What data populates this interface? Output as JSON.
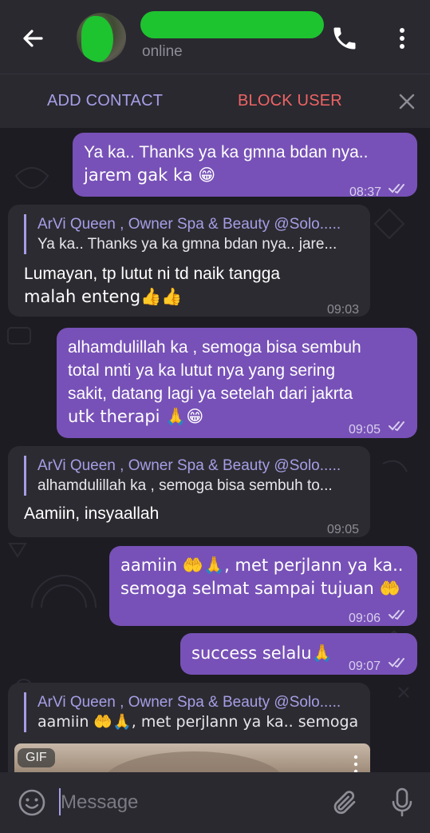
{
  "header": {
    "status": "online",
    "icons": {
      "back": "arrow-left-icon",
      "call": "phone-icon",
      "menu": "more-vertical-icon"
    }
  },
  "actionbar": {
    "add_contact": "ADD CONTACT",
    "block_user": "BLOCK USER",
    "close_icon": "close-icon"
  },
  "colors": {
    "outgoing_bubble": "#7751b7",
    "incoming_bubble": "#2c2b31",
    "accent": "#a59ee6",
    "danger": "#ee6464"
  },
  "messages": [
    {
      "direction": "out",
      "lines": [
        "Ya ka.. Thanks ya ka gmna bdan nya..",
        "jarem gak ka 😁"
      ],
      "time": "08:37",
      "read": true
    },
    {
      "direction": "in",
      "reply_name": "ArVi Queen , Owner Spa & Beauty @Solo.....",
      "reply_text": "Ya ka.. Thanks ya ka gmna bdan nya.. jare...",
      "lines": [
        "Lumayan, tp lutut ni td naik tangga",
        "malah enteng👍👍"
      ],
      "time": "09:03"
    },
    {
      "direction": "out",
      "lines": [
        "alhamdulillah ka , semoga bisa sembuh",
        "total nnti ya ka lutut nya yang sering",
        "sakit,  datang lagi ya setelah dari jakrta",
        "utk therapi 🙏😁"
      ],
      "time": "09:05",
      "read": true
    },
    {
      "direction": "in",
      "reply_name": "ArVi Queen , Owner Spa & Beauty @Solo.....",
      "reply_text": "alhamdulillah ka , semoga bisa sembuh to...",
      "lines": [
        "Aamiin, insyaallah"
      ],
      "time": "09:05"
    },
    {
      "direction": "out",
      "lines": [
        "aamiin 🤲🙏, met perjlann ya ka..",
        "semoga selmat sampai tujuan 🤲"
      ],
      "time": "09:06",
      "read": true
    },
    {
      "direction": "out",
      "lines": [
        "success selalu🙏"
      ],
      "time": "09:07",
      "read": true
    },
    {
      "direction": "in",
      "reply_name": "ArVi Queen , Owner Spa & Beauty @Solo.....",
      "reply_text": "aamiin 🤲🙏, met perjlann ya ka.. semoga...",
      "gif_label": "GIF"
    }
  ],
  "input": {
    "placeholder": "Message",
    "icons": {
      "emoji": "emoji-smile-icon",
      "attach": "paperclip-icon",
      "mic": "microphone-icon"
    }
  }
}
